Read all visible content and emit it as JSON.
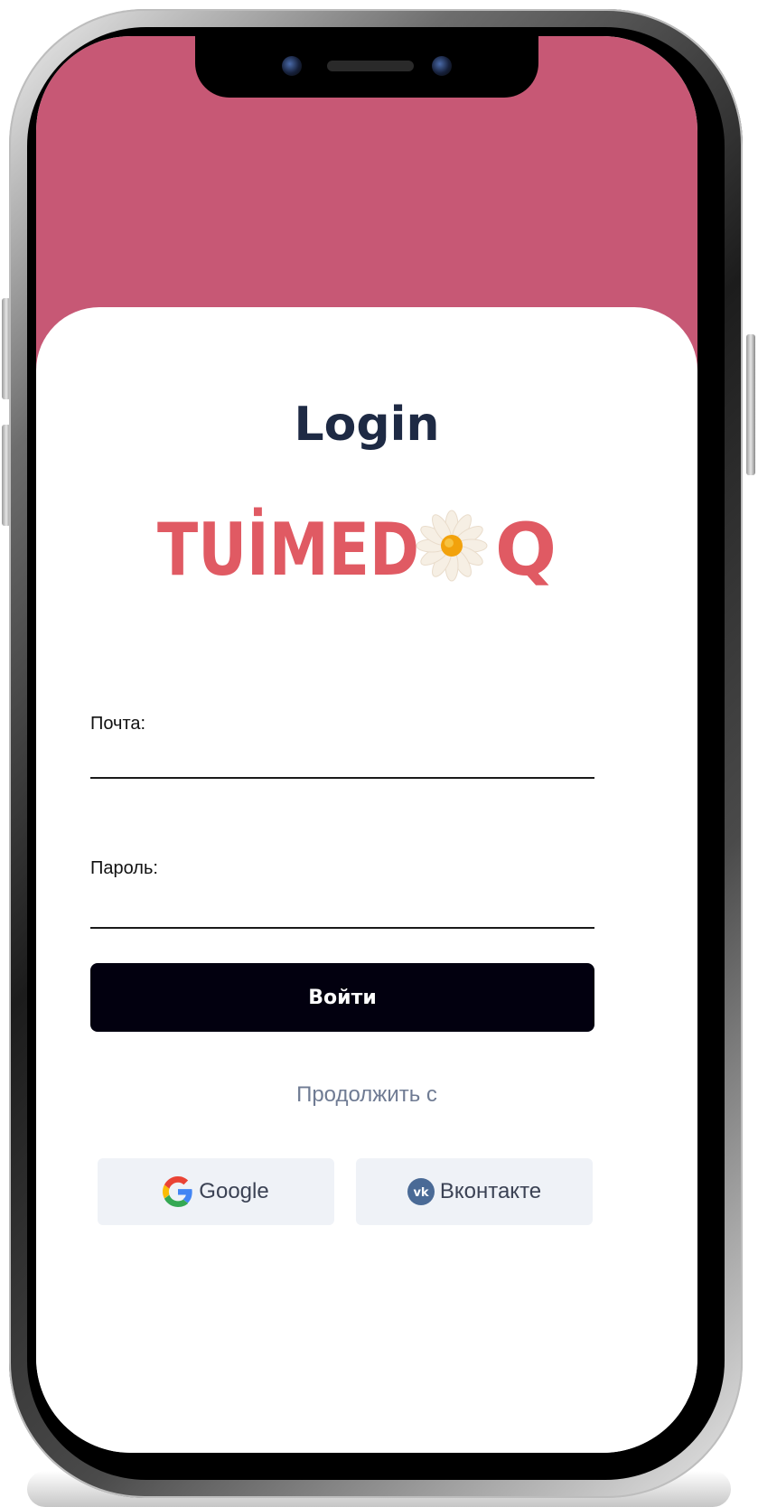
{
  "screen": {
    "title": "Login",
    "logo_text": "TUİMED",
    "logo_text_tail": "Q"
  },
  "form": {
    "email_label": "Почта:",
    "email_value": "",
    "password_label": "Пароль:",
    "password_value": "",
    "submit_label": "Войти"
  },
  "social": {
    "continue_label": "Продолжить с",
    "google_label": "Google",
    "vk_label": "Вконтакте"
  },
  "colors": {
    "header": "#c75875",
    "logo": "#e05a63",
    "button": "#02000f",
    "title": "#1e2a44"
  },
  "icons": [
    "google-icon",
    "vk-icon",
    "daisy-icon"
  ]
}
